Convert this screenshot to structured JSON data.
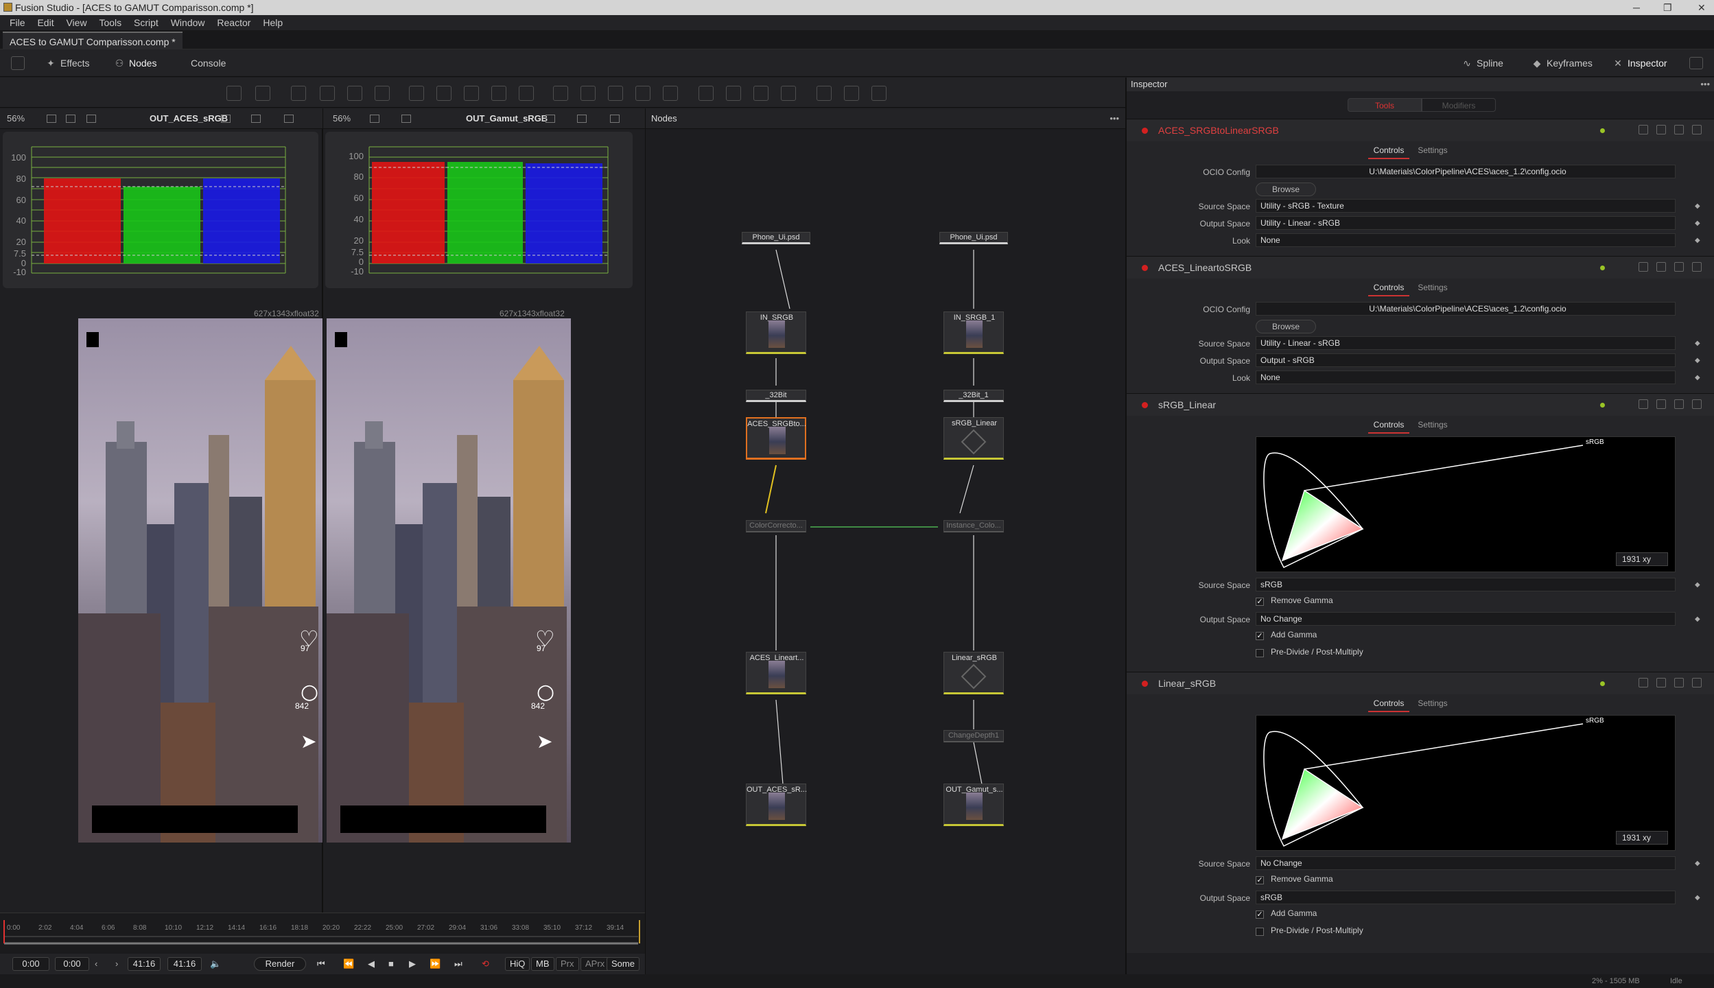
{
  "window": {
    "title": "Fusion Studio - [ACES to GAMUT Comparisson.comp *]",
    "minimize": "─",
    "maximize": "❐",
    "close": "✕"
  },
  "menu": [
    "File",
    "Edit",
    "View",
    "Tools",
    "Script",
    "Window",
    "Reactor",
    "Help"
  ],
  "doc_tab": "ACES to GAMUT Comparisson.comp *",
  "toolbar": {
    "effects": "Effects",
    "nodes": "Nodes",
    "console": "Console",
    "spline": "Spline",
    "keyframes": "Keyframes",
    "inspector": "Inspector"
  },
  "viewer_left": {
    "zoom": "56%",
    "name": "OUT_ACES_sRGB",
    "resolution": "627x1343xfloat32"
  },
  "viewer_right": {
    "zoom": "56%",
    "name": "OUT_Gamut_sRGB",
    "resolution": "627x1343xfloat32"
  },
  "scope_labels": [
    "100",
    "80",
    "60",
    "40",
    "20",
    "7.5",
    "0",
    "-10"
  ],
  "overlay": {
    "likes": "97",
    "comments": "842"
  },
  "nodes_panel": {
    "title": "Nodes"
  },
  "nodes": {
    "phone_left": "Phone_Ui.psd",
    "phone_right": "Phone_Ui.psd",
    "in_srgb": "IN_SRGB",
    "in_srgb1": "IN_SRGB_1",
    "bit32": "_32Bit",
    "bit32_1": "_32Bit_1",
    "aces_srgb": "ACES_SRGBto...",
    "srgb_linear": "sRGB_Linear",
    "colorcorr": "ColorCorrecto...",
    "instance": "Instance_Colo...",
    "aces_lin": "ACES_Lineart...",
    "linear_srgb": "Linear_sRGB",
    "changedepth": "ChangeDepth1",
    "out_aces": "OUT_ACES_sR...",
    "out_gamut": "OUT_Gamut_s..."
  },
  "inspector": {
    "title": "Inspector",
    "tab_tools": "Tools",
    "tab_modifiers": "Modifiers",
    "controls": "Controls",
    "settings": "Settings",
    "s1": {
      "name": "ACES_SRGBtoLinearSRGB",
      "ocio_label": "OCIO Config",
      "ocio": "U:\\Materials\\ColorPipeline\\ACES\\aces_1.2\\config.ocio",
      "browse": "Browse",
      "src_label": "Source Space",
      "src": "Utility - sRGB - Texture",
      "out_label": "Output Space",
      "out": "Utility - Linear - sRGB",
      "look_label": "Look",
      "look": "None"
    },
    "s2": {
      "name": "ACES_LineartoSRGB",
      "ocio_label": "OCIO Config",
      "ocio": "U:\\Materials\\ColorPipeline\\ACES\\aces_1.2\\config.ocio",
      "browse": "Browse",
      "src_label": "Source Space",
      "src": "Utility - Linear - sRGB",
      "out_label": "Output Space",
      "out": "Output - sRGB",
      "look_label": "Look",
      "look": "None"
    },
    "s3": {
      "name": "sRGB_Linear",
      "gamut_label": "sRGB",
      "xy": "1931 xy",
      "src_label": "Source Space",
      "src": "sRGB",
      "remove_gamma": "Remove Gamma",
      "out_label": "Output Space",
      "out": "No Change",
      "add_gamma": "Add Gamma",
      "premult": "Pre-Divide / Post-Multiply"
    },
    "s4": {
      "name": "Linear_sRGB",
      "gamut_label": "sRGB",
      "xy": "1931 xy",
      "src_label": "Source Space",
      "src": "No Change",
      "remove_gamma": "Remove Gamma",
      "out_label": "Output Space",
      "out": "sRGB",
      "add_gamma": "Add Gamma",
      "premult": "Pre-Divide / Post-Multiply"
    }
  },
  "timeline": {
    "ticks": [
      "0:00",
      "2:02",
      "4:04",
      "6:06",
      "8:08",
      "10:10",
      "12:12",
      "14:14",
      "16:16",
      "18:18",
      "20:20",
      "22:22",
      "25:00",
      "27:02",
      "29:04",
      "31:06",
      "33:08",
      "35:10",
      "37:12",
      "39:14"
    ],
    "start": "0:00",
    "current": "0:00",
    "end1": "41:16",
    "end2": "41:16",
    "render": "Render",
    "hiq": "HiQ",
    "mb": "MB",
    "prx": "Prx",
    "aprx": "APrx",
    "some": "Some"
  },
  "status": {
    "memory": "2% - 1505 MB",
    "state": "Idle"
  },
  "colors": {
    "accent_red": "#d32020",
    "node_bar": "#c7c735",
    "selected": "#e07020"
  }
}
